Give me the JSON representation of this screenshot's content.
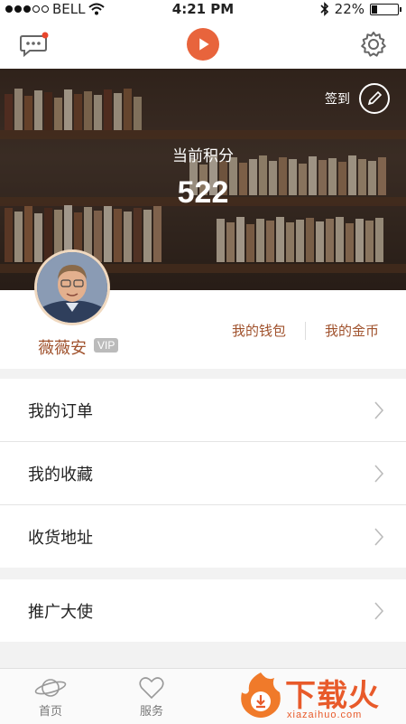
{
  "status_bar": {
    "carrier": "BELL",
    "time": "4:21 PM",
    "battery": "22%",
    "battery_level": 0.22
  },
  "nav": {
    "message_icon": "chat-bubble-icon",
    "play_icon": "play-icon",
    "settings_icon": "gear-icon",
    "accent_color": "#e8643c"
  },
  "hero": {
    "signin_label": "签到",
    "points_label": "当前积分",
    "points_value": "522"
  },
  "profile": {
    "username": "薇薇安",
    "vip_badge": "VIP",
    "wallet_label": "我的钱包",
    "coins_label": "我的金币",
    "name_color": "#a0522d"
  },
  "menu_group_1": [
    {
      "label": "我的订单"
    },
    {
      "label": "我的收藏"
    },
    {
      "label": "收货地址"
    }
  ],
  "menu_group_2": [
    {
      "label": "推广大使"
    }
  ],
  "tabbar": {
    "tabs": [
      {
        "label": "首页",
        "icon": "planet-icon"
      },
      {
        "label": "服务",
        "icon": "heart-icon"
      }
    ]
  },
  "watermark": {
    "text": "下载火",
    "sub": "xiazaihuo.com"
  }
}
